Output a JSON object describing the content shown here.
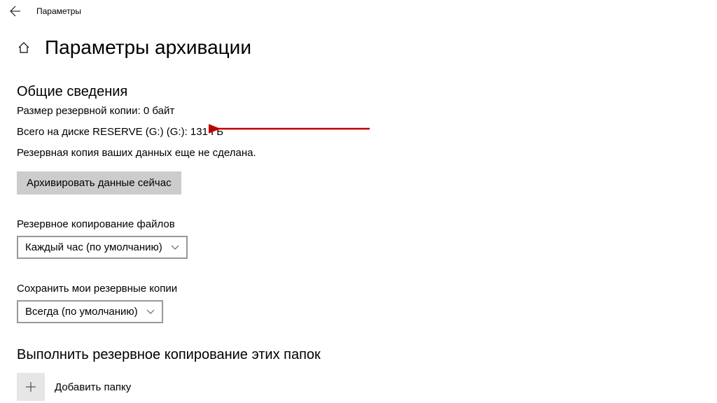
{
  "titleBar": {
    "windowTitle": "Параметры"
  },
  "header": {
    "pageTitle": "Параметры архивации"
  },
  "overview": {
    "heading": "Общие сведения",
    "backupSize": "Размер резервной копии: 0 байт",
    "diskTotal": "Всего на диске RESERVE (G:) (G:): 131 ГБ",
    "notBackedUp": "Резервная копия ваших данных еще не сделана.",
    "backupNowButton": "Архивировать данные сейчас"
  },
  "backupFiles": {
    "label": "Резервное копирование файлов",
    "selected": "Каждый час (по умолчанию)"
  },
  "keepBackups": {
    "label": "Сохранить мои резервные копии",
    "selected": "Всегда (по умолчанию)"
  },
  "folders": {
    "heading": "Выполнить резервное копирование этих папок",
    "addFolder": "Добавить папку"
  }
}
